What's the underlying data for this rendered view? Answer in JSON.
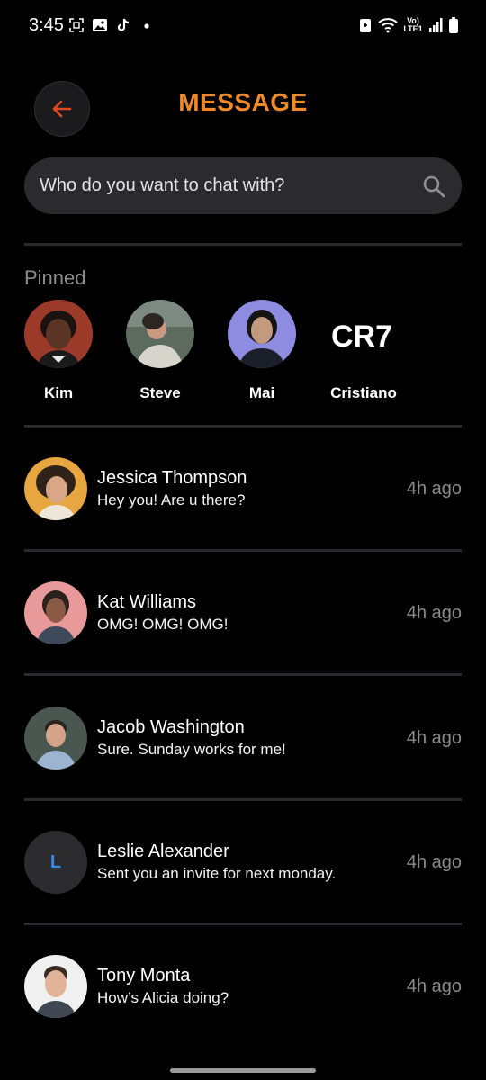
{
  "status_bar": {
    "time": "3:45",
    "network_label": "Vo) LTE1",
    "left_icons": [
      "screenshot-icon",
      "gallery-icon",
      "tiktok-icon",
      "dot-icon"
    ],
    "right_icons": [
      "alarm-icon",
      "wifi-icon",
      "signal-icon",
      "battery-icon"
    ]
  },
  "header": {
    "title": "MESSAGE",
    "back_icon": "arrow-left-icon",
    "accent_color": "#ef8a2b",
    "back_icon_color": "#e2481f"
  },
  "search": {
    "placeholder": "Who do you want to chat with?",
    "icon": "search-icon"
  },
  "pinned": {
    "label": "Pinned",
    "items": [
      {
        "name": "Kim"
      },
      {
        "name": "Steve"
      },
      {
        "name": "Mai"
      },
      {
        "name": "Cristiano",
        "logo_text": "CR7"
      }
    ]
  },
  "chats": [
    {
      "name": "Jessica Thompson",
      "message": "Hey you! Are u there?",
      "time": "4h ago"
    },
    {
      "name": "Kat Williams",
      "message": "OMG! OMG! OMG!",
      "time": "4h ago"
    },
    {
      "name": "Jacob Washington",
      "message": "Sure. Sunday works for me!",
      "time": "4h ago"
    },
    {
      "name": "Leslie Alexander",
      "message": "Sent you an invite for next monday.",
      "time": "4h ago",
      "initial": "L"
    },
    {
      "name": "Tony Monta",
      "message": "How’s Alicia doing?",
      "time": "4h ago"
    }
  ]
}
